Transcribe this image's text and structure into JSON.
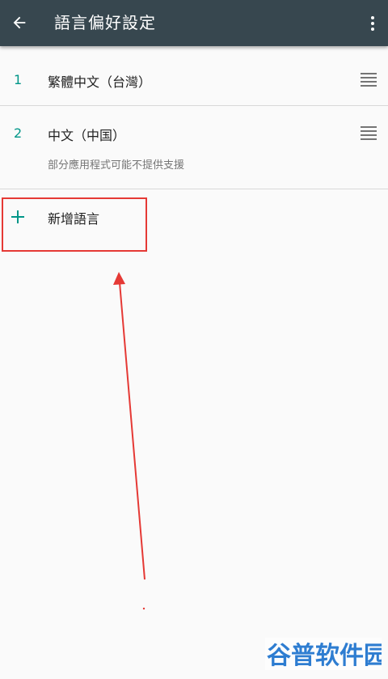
{
  "appbar": {
    "title": "語言偏好設定",
    "back_icon": "arrow-back-icon",
    "overflow_icon": "more-vert-icon"
  },
  "languages": [
    {
      "number": "1",
      "name": "繁體中文（台灣）",
      "subtitle": ""
    },
    {
      "number": "2",
      "name": "中文（中国）",
      "subtitle": "部分應用程式可能不提供支援"
    }
  ],
  "add_language": {
    "label": "新增語言",
    "icon": "plus-icon"
  },
  "watermark": {
    "text": "谷普软件园"
  },
  "colors": {
    "appbar": "#37474f",
    "accent": "#009688",
    "annotation": "#e53935",
    "background": "#fafafa"
  }
}
